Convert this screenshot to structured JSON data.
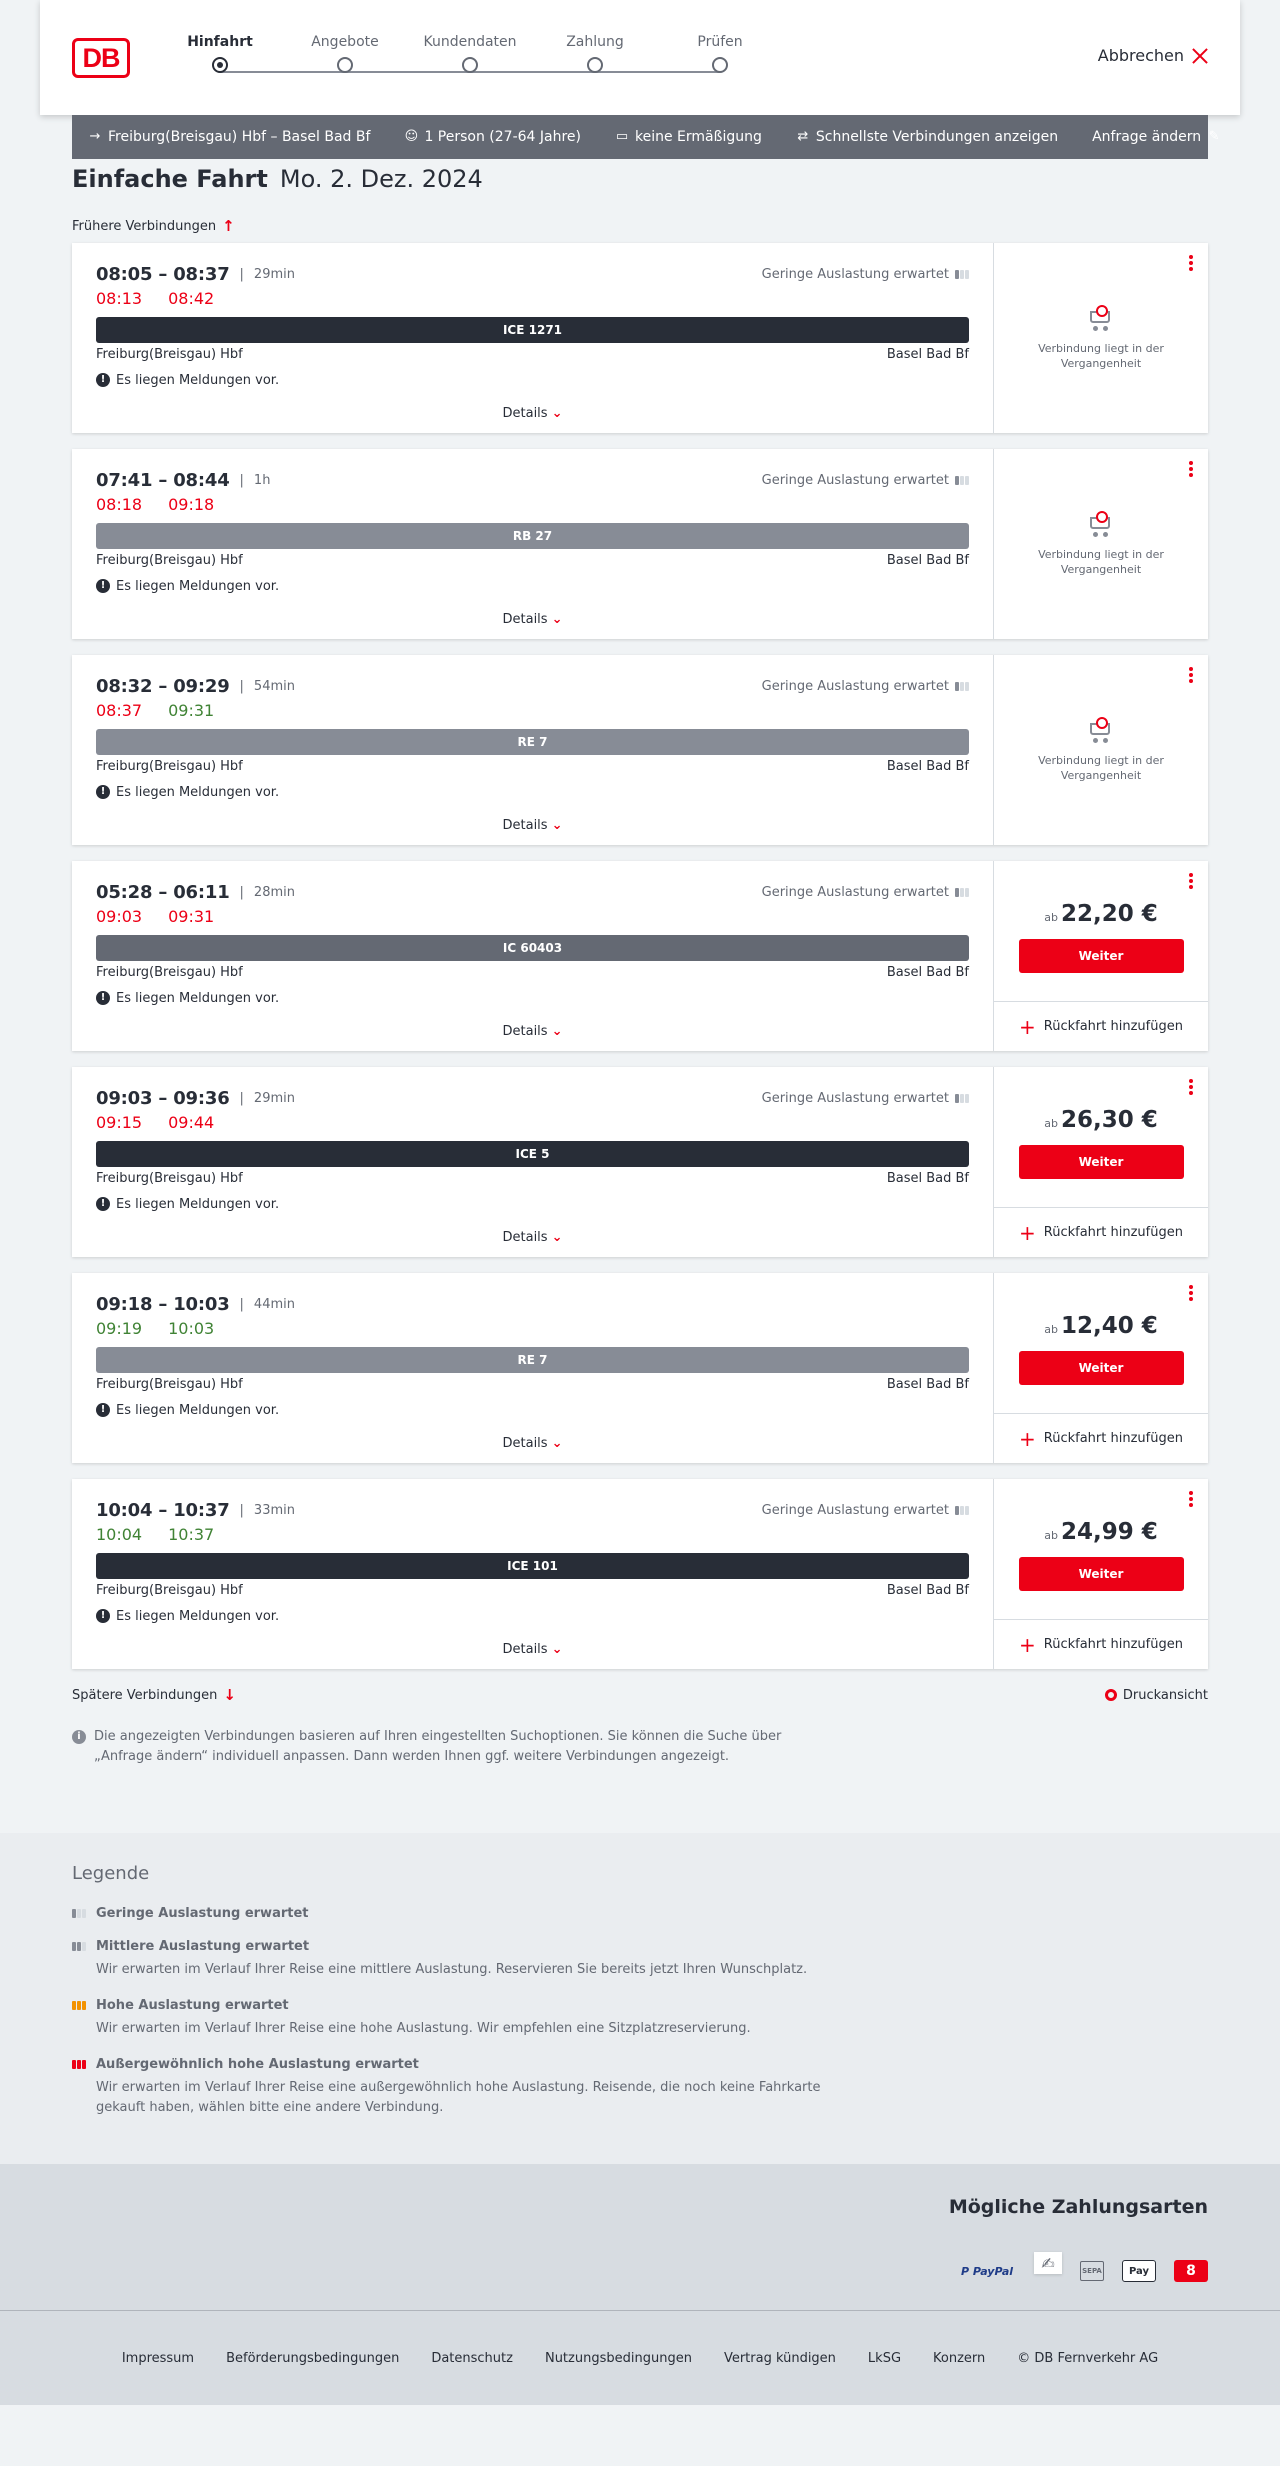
{
  "header": {
    "logo_text": "DB",
    "steps": [
      {
        "label": "Hinfahrt",
        "active": true
      },
      {
        "label": "Angebote",
        "active": false
      },
      {
        "label": "Kundendaten",
        "active": false
      },
      {
        "label": "Zahlung",
        "active": false
      },
      {
        "label": "Prüfen",
        "active": false
      }
    ],
    "cancel_label": "Abbrechen"
  },
  "search": {
    "route": "Freiburg(Breisgau) Hbf – Basel Bad Bf",
    "passengers": "1 Person (27-64 Jahre)",
    "discount": "keine Ermäßigung",
    "option": "Schnellste Verbindungen anzeigen",
    "edit": "Anfrage ändern"
  },
  "main": {
    "title": "Einfache Fahrt",
    "date": "Mo. 2. Dez. 2024",
    "earlier": "Frühere Verbindungen",
    "later": "Spätere Verbindungen",
    "print": "Druckansicht",
    "hint": "Die angezeigten Verbindungen basieren auf Ihren eingestellten Suchoptionen. Sie können die Suche über „Anfrage ändern“ individuell anpassen. Dann werden Ihnen ggf. weitere Verbindungen angezeigt.",
    "details_label": "Details",
    "message_label": "Es liegen Meldungen vor.",
    "past_label": "Verbindung liegt in der Vergangenheit",
    "price_prefix": "ab",
    "continue_label": "Weiter",
    "return_label": "Rückfahrt hinzufügen"
  },
  "connections": [
    {
      "times": "08:05 – 08:37",
      "duration": "29min",
      "load": "Geringe Auslastung erwartet",
      "rt_dep": "08:13",
      "rt_arr": "08:42",
      "rt_dep_color": "red",
      "rt_arr_color": "red",
      "train": "ICE 1271",
      "bar": "dark",
      "from": "Freiburg(Breisgau) Hbf",
      "to": "Basel Bad Bf",
      "past": true,
      "price": ""
    },
    {
      "times": "07:41 – 08:44",
      "duration": "1h",
      "load": "Geringe Auslastung erwartet",
      "rt_dep": "08:18",
      "rt_arr": "09:18",
      "rt_dep_color": "red",
      "rt_arr_color": "red",
      "train": "RB 27",
      "bar": "grey",
      "from": "Freiburg(Breisgau) Hbf",
      "to": "Basel Bad Bf",
      "past": true,
      "price": ""
    },
    {
      "times": "08:32 – 09:29",
      "duration": "54min",
      "load": "Geringe Auslastung erwartet",
      "rt_dep": "08:37",
      "rt_arr": "09:31",
      "rt_dep_color": "red",
      "rt_arr_color": "green",
      "train": "RE 7",
      "bar": "grey",
      "from": "Freiburg(Breisgau) Hbf",
      "to": "Basel Bad Bf",
      "past": true,
      "price": ""
    },
    {
      "times": "05:28 – 06:11",
      "duration": "28min",
      "load": "Geringe Auslastung erwartet",
      "rt_dep": "09:03",
      "rt_arr": "09:31",
      "rt_dep_color": "red",
      "rt_arr_color": "red",
      "train": "IC 60403",
      "bar": "mid",
      "from": "Freiburg(Breisgau) Hbf",
      "to": "Basel Bad Bf",
      "past": false,
      "price": "22,20 €"
    },
    {
      "times": "09:03 – 09:36",
      "duration": "29min",
      "load": "Geringe Auslastung erwartet",
      "rt_dep": "09:15",
      "rt_arr": "09:44",
      "rt_dep_color": "red",
      "rt_arr_color": "red",
      "train": "ICE 5",
      "bar": "dark",
      "from": "Freiburg(Breisgau) Hbf",
      "to": "Basel Bad Bf",
      "past": false,
      "price": "26,30 €"
    },
    {
      "times": "09:18 – 10:03",
      "duration": "44min",
      "load": "",
      "rt_dep": "09:19",
      "rt_arr": "10:03",
      "rt_dep_color": "green",
      "rt_arr_color": "green",
      "train": "RE 7",
      "bar": "grey",
      "from": "Freiburg(Breisgau) Hbf",
      "to": "Basel Bad Bf",
      "past": false,
      "price": "12,40 €"
    },
    {
      "times": "10:04 – 10:37",
      "duration": "33min",
      "load": "Geringe Auslastung erwartet",
      "rt_dep": "10:04",
      "rt_arr": "10:37",
      "rt_dep_color": "green",
      "rt_arr_color": "green",
      "train": "ICE 101",
      "bar": "dark",
      "from": "Freiburg(Breisgau) Hbf",
      "to": "Basel Bad Bf",
      "past": false,
      "price": "24,99 €"
    }
  ],
  "legend": {
    "title": "Legende",
    "items": [
      {
        "level": "low",
        "label": "Geringe Auslastung erwartet",
        "desc": ""
      },
      {
        "level": "mid",
        "label": "Mittlere Auslastung erwartet",
        "desc": "Wir erwarten im Verlauf Ihrer Reise eine mittlere Auslastung. Reservieren Sie bereits jetzt Ihren Wunschplatz."
      },
      {
        "level": "high",
        "label": "Hohe Auslastung erwartet",
        "desc": "Wir erwarten im Verlauf Ihrer Reise eine hohe Auslastung. Wir empfehlen eine Sitzplatzreservierung."
      },
      {
        "level": "ext",
        "label": "Außergewöhnlich hohe Auslastung erwartet",
        "desc": "Wir erwarten im Verlauf Ihrer Reise eine außergewöhnlich hohe Auslastung. Reisende, die noch keine Fahrkarte gekauft haben, wählen bitte eine andere Verbindung."
      }
    ]
  },
  "payment": {
    "title": "Mögliche Zahlungsarten",
    "methods": [
      "PayPal",
      "Kreditkarte",
      "SEPA",
      "Apple Pay",
      "DB Bonus"
    ],
    "paypal_text": "P PayPal",
    "apple_text": " Pay",
    "sepa_text": "SEPA",
    "bonus_text": "8"
  },
  "footer": {
    "links": [
      "Impressum",
      "Beförderungsbedingungen",
      "Datenschutz",
      "Nutzungsbedingungen",
      "Vertrag kündigen",
      "LkSG",
      "Konzern",
      "© DB Fernverkehr AG"
    ]
  },
  "colors": {
    "accent": "#ec0016",
    "delay": "#ec0016",
    "ontime": "#408335",
    "dark": "#282d37"
  }
}
